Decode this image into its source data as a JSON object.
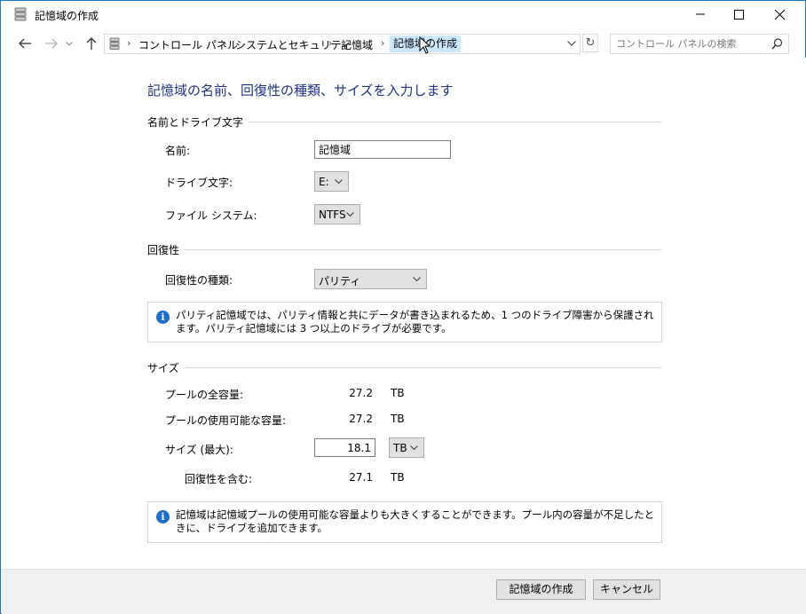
{
  "window": {
    "title": "記憶域の作成"
  },
  "navigation": {
    "back_icon": "back-arrow-icon",
    "forward_icon": "forward-arrow-icon",
    "up_icon": "up-arrow-icon",
    "breadcrumb": [
      "コントロール パネル",
      "システムとセキュリティ",
      "記憶域",
      "記憶域の作成"
    ],
    "search_placeholder": "コントロール パネルの検索"
  },
  "page": {
    "heading": "記憶域の名前、回復性の種類、サイズを入力します",
    "name_section": {
      "title": "名前とドライブ文字",
      "name_label": "名前:",
      "name_value": "記憶域",
      "drive_label": "ドライブ文字:",
      "drive_value": "E:",
      "fs_label": "ファイル システム:",
      "fs_value": "NTFS"
    },
    "resiliency_section": {
      "title": "回復性",
      "type_label": "回復性の種類:",
      "type_value": "パリティ",
      "info": "パリティ記憶域では、パリティ情報と共にデータが書き込まれるため、1 つのドライブ障害から保護されます。パリティ記憶域には 3 つ以上のドライブが必要です。"
    },
    "size_section": {
      "title": "サイズ",
      "total_label": "プールの全容量:",
      "total_value": "27.2",
      "total_unit": "TB",
      "available_label": "プールの使用可能な容量:",
      "available_value": "27.2",
      "available_unit": "TB",
      "max_label": "サイズ (最大):",
      "max_value": "18.1",
      "max_unit": "TB",
      "incl_label": "回復性を含む:",
      "incl_value": "27.1",
      "incl_unit": "TB",
      "info": "記憶域は記憶域プールの使用可能な容量よりも大きくすることができます。プール内の容量が不足したときに、ドライブを追加できます。"
    }
  },
  "footer": {
    "create_label": "記憶域の作成",
    "cancel_label": "キャンセル"
  },
  "colors": {
    "heading": "#1e3287",
    "info_icon": "#1c70c8",
    "window_border": "#1979ca",
    "crumb_highlight": "#cce8ff"
  }
}
